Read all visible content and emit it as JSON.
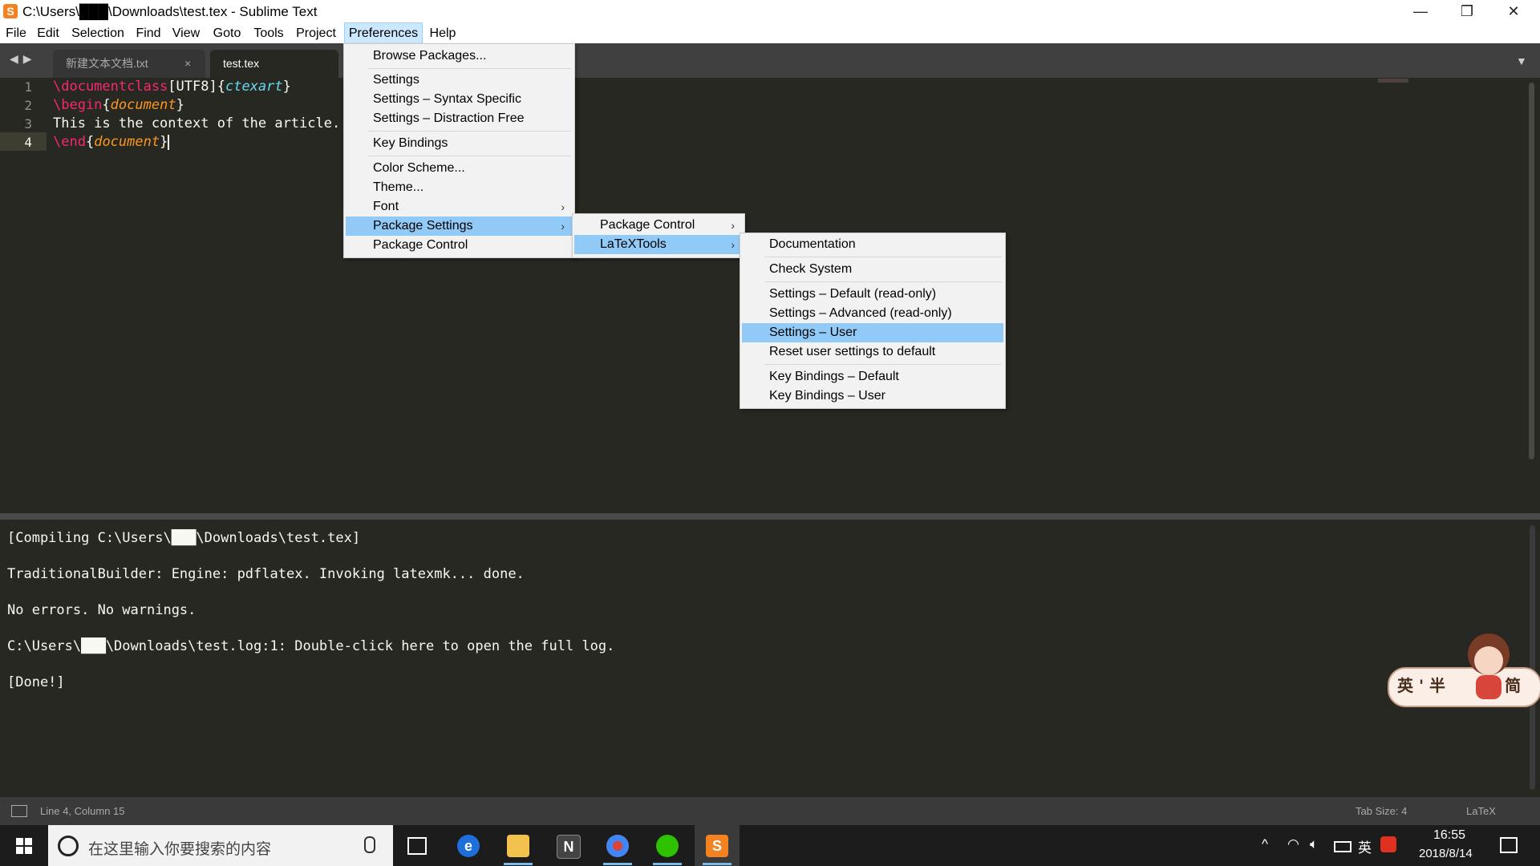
{
  "window": {
    "app_icon": "S",
    "title": "C:\\Users\\███\\Downloads\\test.tex - Sublime Text",
    "minimize": "—",
    "maximize": "❐",
    "close": "✕"
  },
  "menubar": {
    "items": [
      "File",
      "Edit",
      "Selection",
      "Find",
      "View",
      "Goto",
      "Tools",
      "Project",
      "Preferences",
      "Help"
    ],
    "active": "Preferences"
  },
  "tabs": [
    {
      "label": "新建文本文档.txt",
      "close": "×"
    },
    {
      "label": "test.tex"
    }
  ],
  "nav": {
    "arrows": "◀▶",
    "dropdown": "▼"
  },
  "editor": {
    "line_numbers": [
      "1",
      "2",
      "3",
      "4"
    ],
    "lines": {
      "l1": {
        "cmd": "\\documentclass",
        "opt": "[UTF8]",
        "open": "{",
        "arg": "ctexart",
        "close": "}"
      },
      "l2": {
        "cmd": "\\begin",
        "open": "{",
        "arg": "document",
        "close": "}"
      },
      "l3": {
        "text": "This is the context of the article."
      },
      "l4": {
        "cmd": "\\end",
        "open": "{",
        "arg": "document",
        "close": "}"
      }
    }
  },
  "output": {
    "lines": [
      "[Compiling C:\\Users\\███\\Downloads\\test.tex]",
      "TraditionalBuilder: Engine: pdflatex. Invoking latexmk... done.",
      "No errors. No warnings.",
      "C:\\Users\\███\\Downloads\\test.log:1: Double-click here to open the full log.",
      "[Done!]"
    ]
  },
  "status": {
    "position": "Line 4, Column 15",
    "tab_size": "Tab Size: 4",
    "syntax": "LaTeX"
  },
  "menus": {
    "preferences": {
      "browse_packages": "Browse Packages...",
      "settings": "Settings",
      "settings_syntax": "Settings – Syntax Specific",
      "settings_distraction": "Settings – Distraction Free",
      "key_bindings": "Key Bindings",
      "color_scheme": "Color Scheme...",
      "theme": "Theme...",
      "font": "Font",
      "package_settings": "Package Settings",
      "package_control": "Package Control",
      "submenu_arrow": "›"
    },
    "package_settings": {
      "package_control": "Package Control",
      "latextools": "LaTeXTools"
    },
    "latextools": {
      "documentation": "Documentation",
      "check_system": "Check System",
      "settings_default": "Settings – Default (read-only)",
      "settings_advanced": "Settings – Advanced (read-only)",
      "settings_user": "Settings – User",
      "reset_user": "Reset user settings to default",
      "kb_default": "Key Bindings – Default",
      "kb_user": "Key Bindings – User"
    }
  },
  "taskbar": {
    "search_placeholder": "在这里输入你要搜索的内容",
    "apps": [
      "task-view",
      "edge",
      "file-explorer",
      "notion",
      "chrome",
      "wechat",
      "sublime-text"
    ],
    "tray": {
      "chevron": "^",
      "ime_lang": "英",
      "time": "16:55",
      "date": "2018/8/14"
    }
  },
  "ime_widget": {
    "text": "英 ' 半",
    "suffix": "简"
  },
  "colors": {
    "editor_bg": "#272822",
    "keyword": "#f92672",
    "argument": "#66d9ef",
    "env_name": "#fd971f",
    "menu_highlight": "#91c9f7"
  }
}
